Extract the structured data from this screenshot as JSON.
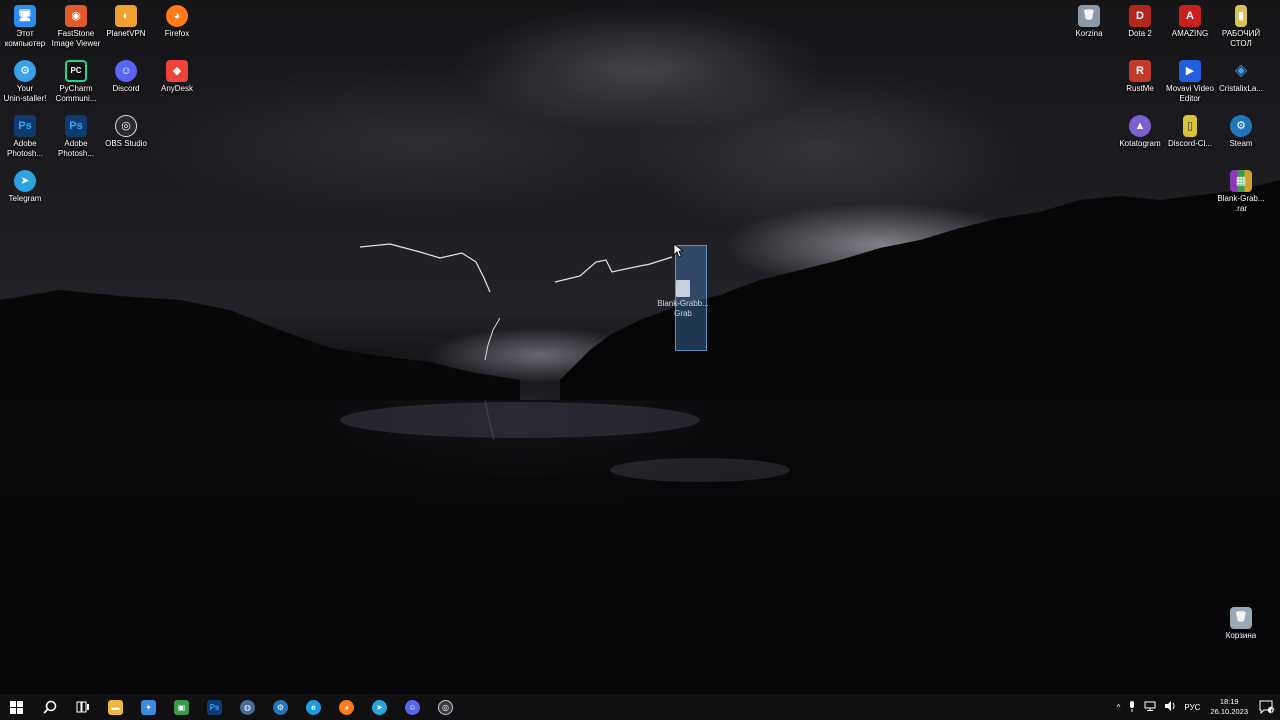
{
  "desktop": {
    "left_icons": [
      {
        "label": "Этот\nкомпьютер",
        "icon": "this-pc-icon",
        "glyph": "🖥",
        "color": "#2d8cf0"
      },
      {
        "label": "FastStone\nImage Viewer",
        "icon": "faststone-icon",
        "glyph": "◉",
        "color": "#e05a2b"
      },
      {
        "label": "PlanetVPN",
        "icon": "planetvpn-icon",
        "glyph": "◐",
        "color": "#f0a030"
      },
      {
        "label": "Firefox",
        "icon": "firefox-icon",
        "glyph": "◕",
        "color": "#ff7a18"
      },
      {
        "label": "Your\nUnin-staller!",
        "icon": "uninstaller-icon",
        "glyph": "⚙",
        "color": "#3aa0e8"
      },
      {
        "label": "PyCharm\nCommuni...",
        "icon": "pycharm-icon",
        "glyph": "PC",
        "color": "#21d789"
      },
      {
        "label": "Discord",
        "icon": "discord-icon",
        "glyph": "☺",
        "color": "#5865f2"
      },
      {
        "label": "AnyDesk",
        "icon": "anydesk-icon",
        "glyph": "◆",
        "color": "#ef443b"
      },
      {
        "label": "Adobe\nPhotosh...",
        "icon": "photoshop-icon",
        "glyph": "Ps",
        "color": "#0f3a6e"
      },
      {
        "label": "Adobe\nPhotosh...",
        "icon": "photoshop-icon",
        "glyph": "Ps",
        "color": "#0f3a6e"
      },
      {
        "label": "OBS Studio",
        "icon": "obs-icon",
        "glyph": "◎",
        "color": "#2b2b2f"
      },
      {
        "label": "Telegram",
        "icon": "telegram-icon",
        "glyph": "➤",
        "color": "#2aa3e0"
      }
    ],
    "right_icons": [
      {
        "label": "Korzina",
        "icon": "recycle-bin-icon",
        "glyph": "🗑",
        "color": "#8a9aa8"
      },
      {
        "label": "Dota 2",
        "icon": "dota2-icon",
        "glyph": "D",
        "color": "#b3261e"
      },
      {
        "label": "AMAZING",
        "icon": "amazing-icon",
        "glyph": "A",
        "color": "#c8201c"
      },
      {
        "label": "РАБОЧИЙ\nСТОЛ",
        "icon": "folder-icon",
        "glyph": "▮",
        "color": "#d9c25a"
      },
      {
        "label": "RustMe",
        "icon": "rustme-icon",
        "glyph": "R",
        "color": "#c43a2a"
      },
      {
        "label": "Movavi Video\nEditor",
        "icon": "movavi-icon",
        "glyph": "▶",
        "color": "#1f5fe0"
      },
      {
        "label": "CristalixLa...",
        "icon": "cristalix-icon",
        "glyph": "◈",
        "color": "#2a78c8"
      },
      {
        "label": "Kotatogram",
        "icon": "kotatogram-icon",
        "glyph": "▲",
        "color": "#7b5fd0"
      },
      {
        "label": "Discord-Cl...",
        "icon": "discord-client-icon",
        "glyph": "▯",
        "color": "#d6c43a"
      },
      {
        "label": "Steam",
        "icon": "steam-icon",
        "glyph": "⚙",
        "color": "#2176b8"
      },
      {
        "label": "Blank-Grab...\n.rar",
        "icon": "rar-archive-icon",
        "glyph": "▦",
        "color": "#8a3ab8"
      },
      {
        "label": "Корзина",
        "icon": "recycle-bin-icon",
        "glyph": "🗑",
        "color": "#9aa8b4"
      }
    ],
    "dragged_item": {
      "label": "Blank-Grabb...\nGrab",
      "icon": "document-icon"
    }
  },
  "taskbar": {
    "start_icon": "windows-start-icon",
    "search_icon": "search-icon",
    "taskview_icon": "task-view-icon",
    "apps": [
      {
        "name": "explorer",
        "icon": "file-explorer-icon",
        "glyph": "▬",
        "color": "#e8b840"
      },
      {
        "name": "fan-app",
        "icon": "fan-app-icon",
        "glyph": "✦",
        "color": "#3a8ae0"
      },
      {
        "name": "store",
        "icon": "store-icon",
        "glyph": "▣",
        "color": "#3a9a4a"
      },
      {
        "name": "photoshop",
        "icon": "photoshop-icon",
        "glyph": "Ps",
        "color": "#0f3a6e"
      },
      {
        "name": "globe",
        "icon": "globe-icon",
        "glyph": "◍",
        "color": "#4a6a9a"
      },
      {
        "name": "steam",
        "icon": "steam-icon",
        "glyph": "⚙",
        "color": "#2176b8"
      },
      {
        "name": "edge",
        "icon": "edge-icon",
        "glyph": "e",
        "color": "#1b9de2"
      },
      {
        "name": "firefox",
        "icon": "firefox-icon",
        "glyph": "◕",
        "color": "#ff7a18"
      },
      {
        "name": "telegram",
        "icon": "telegram-icon",
        "glyph": "➤",
        "color": "#2aa3e0"
      },
      {
        "name": "discord",
        "icon": "discord-icon",
        "glyph": "☺",
        "color": "#5865f2"
      },
      {
        "name": "obs",
        "icon": "obs-icon",
        "glyph": "◎",
        "color": "#3a3a3f"
      }
    ],
    "tray": {
      "chevron": "^",
      "language": "РУС",
      "time": "18:19",
      "date": "26.10.2023",
      "notification_count": "6"
    }
  }
}
